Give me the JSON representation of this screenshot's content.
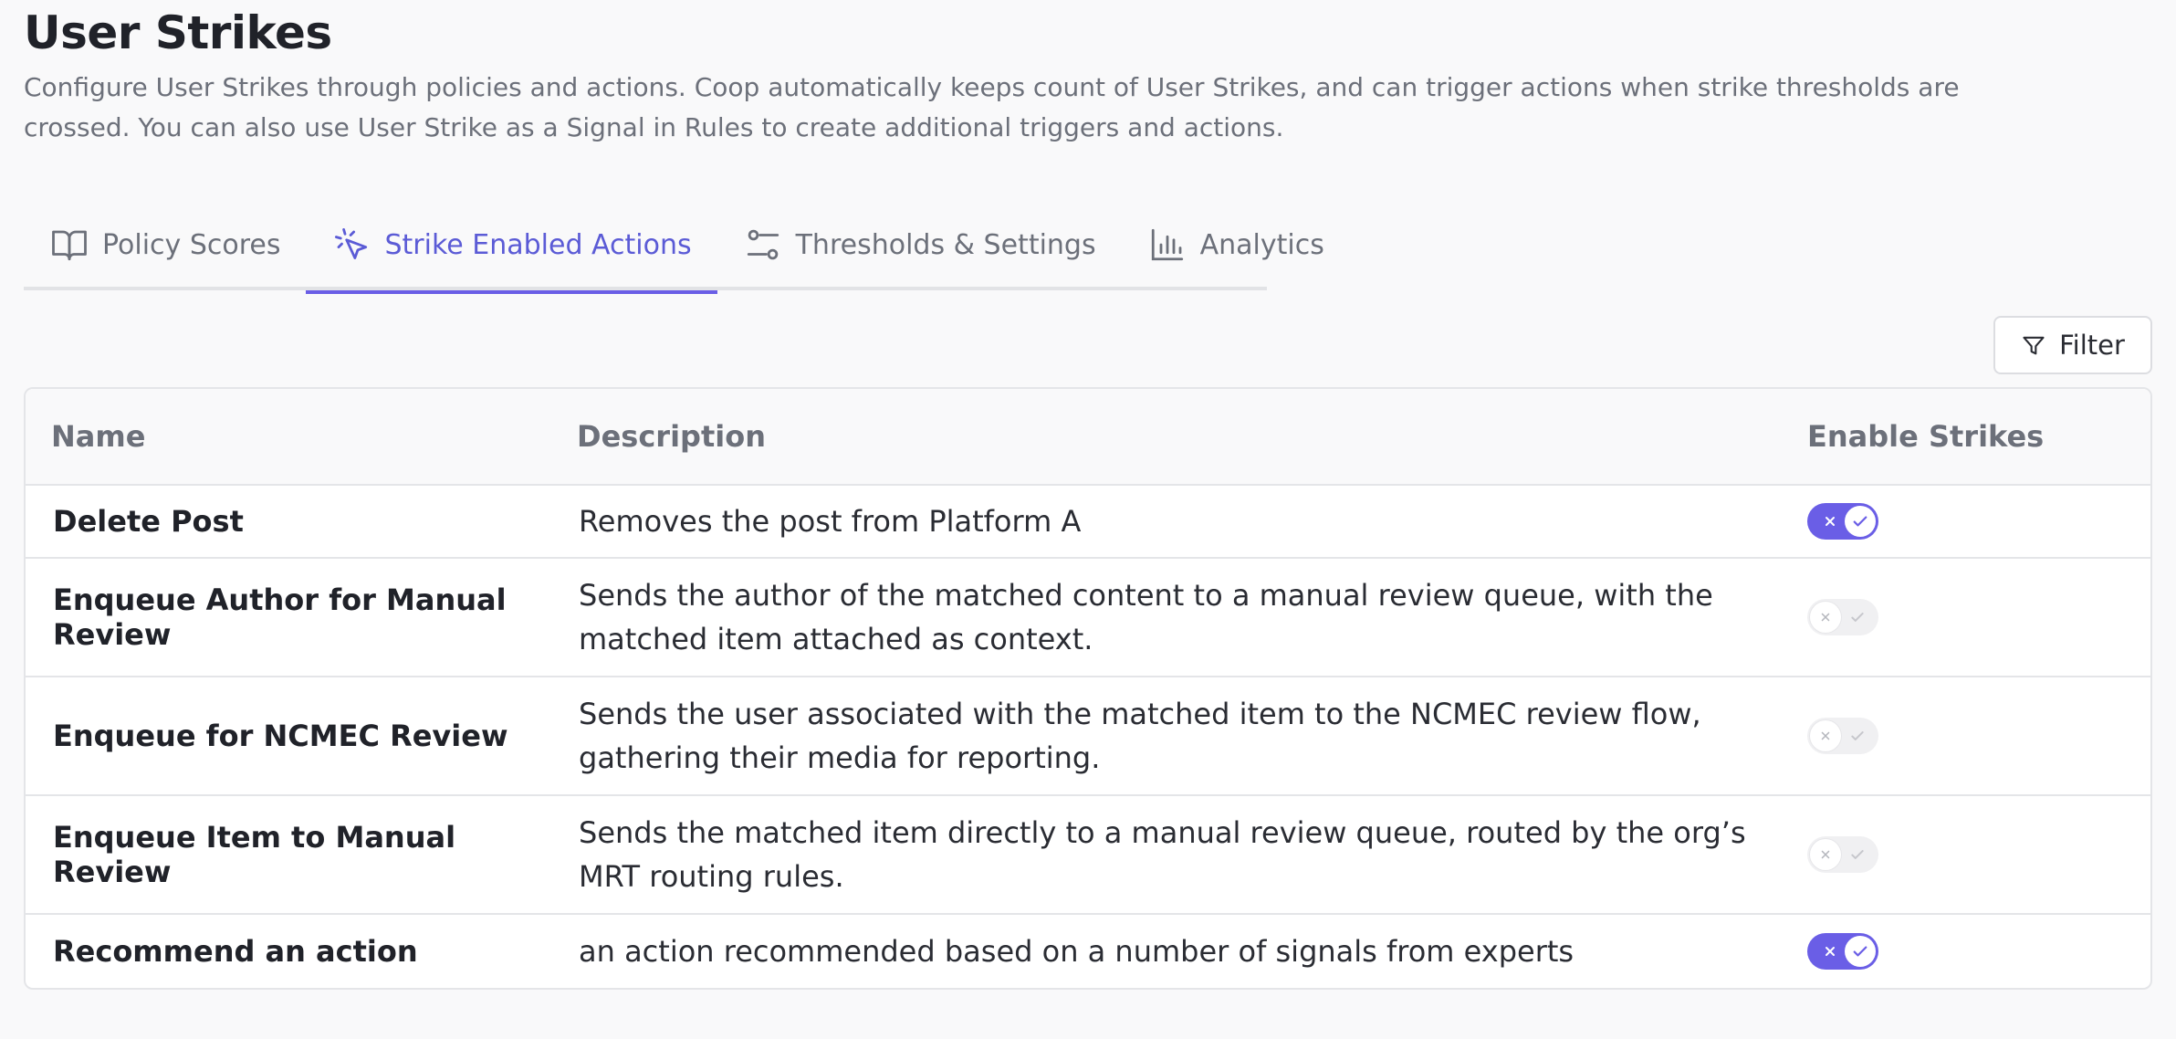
{
  "page": {
    "title": "User Strikes",
    "description": "Configure User Strikes through policies and actions. Coop automatically keeps count of User Strikes, and can trigger actions when strike thresholds are crossed. You can also use User Strike as a Signal in Rules to create additional triggers and actions."
  },
  "tabs": [
    {
      "label": "Policy Scores",
      "icon": "book-open-icon",
      "active": false
    },
    {
      "label": "Strike Enabled Actions",
      "icon": "cursor-click-icon",
      "active": true
    },
    {
      "label": "Thresholds & Settings",
      "icon": "sliders-icon",
      "active": false
    },
    {
      "label": "Analytics",
      "icon": "bar-chart-icon",
      "active": false
    }
  ],
  "filter": {
    "label": "Filter",
    "icon": "filter-icon"
  },
  "table": {
    "headers": {
      "name": "Name",
      "description": "Description",
      "enable": "Enable Strikes"
    },
    "rows": [
      {
        "name": "Delete Post",
        "description": "Removes the post from Platform A",
        "enabled": true
      },
      {
        "name": "Enqueue Author for Manual Review",
        "description": "Sends the author of the matched content to a manual review queue, with the matched item attached as context.",
        "enabled": false
      },
      {
        "name": "Enqueue for NCMEC Review",
        "description": "Sends the user associated with the matched item to the NCMEC review flow, gathering their media for reporting.",
        "enabled": false
      },
      {
        "name": "Enqueue Item to Manual Review",
        "description": "Sends the matched item directly to a manual review queue, routed by the org’s MRT routing rules.",
        "enabled": false
      },
      {
        "name": "Recommend an action",
        "description": "an action recommended based on a number of signals from experts",
        "enabled": true
      }
    ]
  },
  "colors": {
    "accent": "#6a5ee6",
    "muted": "#6c707a",
    "border": "#e4e5e8"
  }
}
